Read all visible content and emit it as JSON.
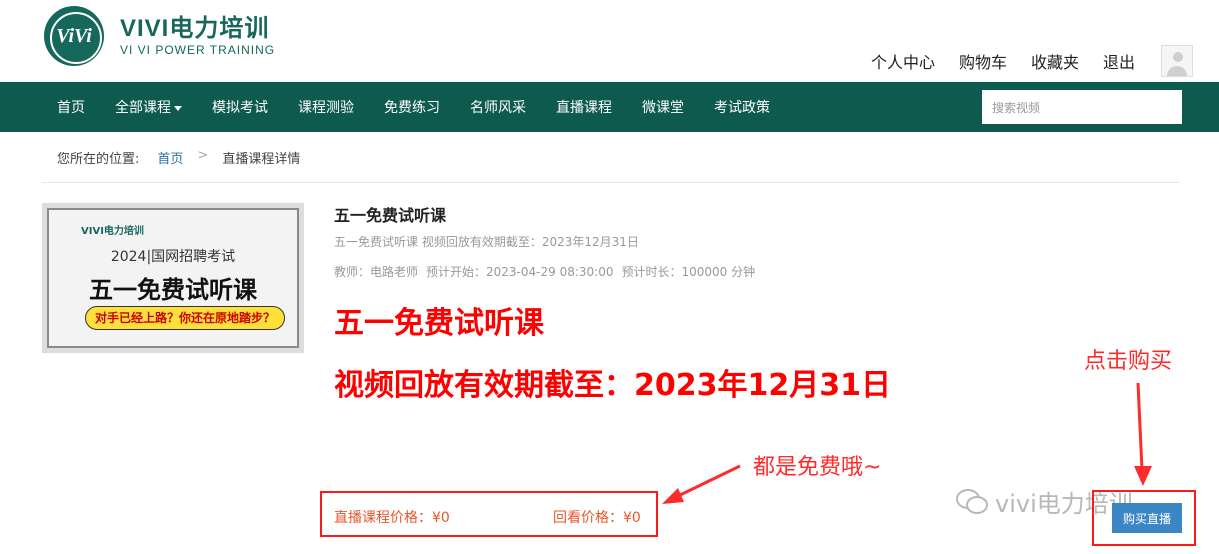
{
  "header": {
    "logo_main": "VIVI电力培训",
    "logo_sub": "VI VI POWER TRAINING",
    "logo_glyph": "ViVi",
    "user_links": [
      "个人中心",
      "购物车",
      "收藏夹",
      "退出"
    ]
  },
  "nav": {
    "items": [
      "首页",
      "全部课程",
      "模拟考试",
      "课程测验",
      "免费练习",
      "名师风采",
      "直播课程",
      "微课堂",
      "考试政策"
    ],
    "search_placeholder": "搜索视频"
  },
  "breadcrumb": {
    "label": "您所在的位置:",
    "home": "首页",
    "separator": ">",
    "current": "直播课程详情"
  },
  "course": {
    "thumb_logo": "VIVI电力培训",
    "thumb_year": "2024|国网招聘考试",
    "thumb_title": "五一免费试听课",
    "thumb_slogan": "对手已经上路？你还在原地踏步？",
    "name": "五一免费试听课",
    "description": "五一免费试听课 视频回放有效期截至：2023年12月31日",
    "teacher": "教师：电路老师",
    "start": "预计开始：2023-04-29 08:30:00",
    "duration": "预计时长：100000 分钟",
    "big_title": "五一免费试听课",
    "big_validity": "视频回放有效期截至：2023年12月31日",
    "live_price": "直播课程价格：¥0",
    "replay_price": "回看价格：¥0",
    "buy_button": "购买直播"
  },
  "annotations": {
    "buy_note": "点击购买",
    "free_note": "都是免费哦~",
    "watermark": "vivi电力培训"
  },
  "colors": {
    "nav_bg": "#0e5a4f",
    "brand": "#16675c",
    "annotation_red": "#ff2a2a",
    "price_orange": "#e8572b",
    "button_blue": "#3d86c6"
  }
}
